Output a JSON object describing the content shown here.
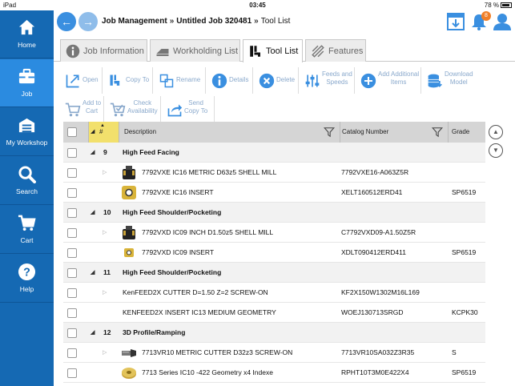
{
  "status": {
    "carrier": "iPad",
    "time": "03:45",
    "battery": "78 %"
  },
  "sidebar": {
    "items": [
      {
        "label": "Home",
        "icon": "home-icon",
        "active": false
      },
      {
        "label": "Job",
        "icon": "briefcase-icon",
        "active": true
      },
      {
        "label": "My Workshop",
        "icon": "workshop-icon",
        "active": false
      },
      {
        "label": "Search",
        "icon": "search-icon",
        "active": false
      },
      {
        "label": "Cart",
        "icon": "cart-icon",
        "active": false
      },
      {
        "label": "Help",
        "icon": "help-icon",
        "active": false
      }
    ]
  },
  "header": {
    "crumb1": "Job Management",
    "sep1": "»",
    "crumb2": "Untitled Job 320481",
    "sep2": "»",
    "crumb3": "Tool List",
    "notifications": "8"
  },
  "tabs": [
    {
      "label": "Job Information",
      "icon": "info-icon",
      "active": false
    },
    {
      "label": "Workholding List",
      "icon": "workholding-icon",
      "active": false
    },
    {
      "label": "Tool List",
      "icon": "tool-icon",
      "active": true
    },
    {
      "label": "Features",
      "icon": "features-icon",
      "active": false
    }
  ],
  "toolbar": {
    "open": "Open",
    "copy_to": "Copy To",
    "rename": "Rename",
    "details": "Details",
    "delete": "Delete",
    "feeds1": "Feeds and",
    "feeds2": "Speeds",
    "add1": "Add Additional",
    "add2": "Items",
    "download1": "Download",
    "download2": "Model",
    "addcart1": "Add to",
    "addcart2": "Cart",
    "check1": "Check",
    "check2": "Availability",
    "send1": "Send",
    "send2": "Copy To"
  },
  "table": {
    "col_num": "#",
    "col_desc": "Description",
    "col_catalog": "Catalog Number",
    "col_grade": "Grade",
    "rows": [
      {
        "type": "group",
        "num": "9",
        "desc": "High Feed Facing"
      },
      {
        "type": "item",
        "desc": "7792VXE IC16 METRIC D63z5 SHELL MILL",
        "catalog": "7792VXE16-A063Z5R",
        "grade": "",
        "thumb": "mill",
        "expandable": true
      },
      {
        "type": "item",
        "desc": "7792VXE IC16 INSERT",
        "catalog": "XELT160512ERD41",
        "grade": "SP6519",
        "thumb": "insert",
        "expandable": false
      },
      {
        "type": "group",
        "num": "10",
        "desc": "High Feed Shoulder/Pocketing"
      },
      {
        "type": "item",
        "desc": "7792VXD IC09  INCH D1.50z5 SHELL MILL",
        "catalog": "C7792VXD09-A1.50Z5R",
        "grade": "",
        "thumb": "mill",
        "expandable": true
      },
      {
        "type": "item",
        "desc": "7792VXD IC09 INSERT",
        "catalog": "XDLT090412ERD411",
        "grade": "SP6519",
        "thumb": "insert-small",
        "expandable": false
      },
      {
        "type": "group",
        "num": "11",
        "desc": "High Feed Shoulder/Pocketing"
      },
      {
        "type": "item",
        "desc": "KenFEED2X CUTTER D=1.50 Z=2 SCREW-ON",
        "catalog": "KF2X150W1302M16L169",
        "grade": "",
        "thumb": "",
        "expandable": true
      },
      {
        "type": "item",
        "desc": "KENFEED2X INSERT IC13 MEDIUM GEOMETRY",
        "catalog": "WOEJ130713SRGD",
        "grade": "KCPK30",
        "thumb": "",
        "expandable": false
      },
      {
        "type": "group",
        "num": "12",
        "desc": "3D Profile/Ramping"
      },
      {
        "type": "item",
        "desc": "7713VR10 METRIC CUTTER D32z3 SCREW-ON",
        "catalog": "7713VR10SA032Z3R35",
        "grade": "S",
        "thumb": "cutter",
        "expandable": true
      },
      {
        "type": "item",
        "desc": "7713 Series IC10 -422 Geometry x4 Indexe",
        "catalog": "RPHT10T3M0E422X4",
        "grade": "SP6519",
        "thumb": "round-insert",
        "expandable": false
      }
    ]
  },
  "colors": {
    "sidebar": "#1569b3",
    "active_nav": "#2b8be0",
    "accent": "#3a8fe0",
    "badge": "#f07f28",
    "toolbar_text": "#8aa9cc",
    "sort_header": "#f2e06c"
  }
}
